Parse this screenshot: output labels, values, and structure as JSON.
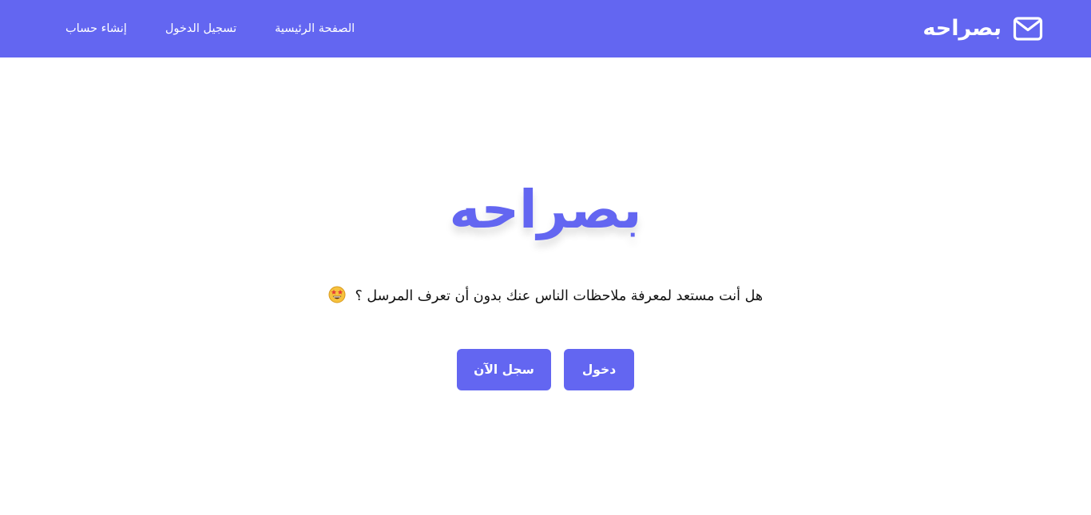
{
  "navbar": {
    "brand_name": "بصراحه",
    "brand_icon": "envelope-icon",
    "links": [
      {
        "label": "الصفحة الرئيسية"
      },
      {
        "label": "تسجيل الدخول"
      },
      {
        "label": "إنشاء حساب"
      }
    ]
  },
  "hero": {
    "logo_text": "بصراحه",
    "tagline": "هل أنت مستعد لمعرفة ملاحظات الناس عنك بدون أن تعرف المرسل ؟",
    "tagline_icon": "star-struck-emoji-icon",
    "buttons": {
      "login_label": "دخول",
      "signup_label": "سجل الآن"
    }
  },
  "colors": {
    "accent": "#6366f1",
    "background": "#ffffff",
    "text": "#111111"
  }
}
